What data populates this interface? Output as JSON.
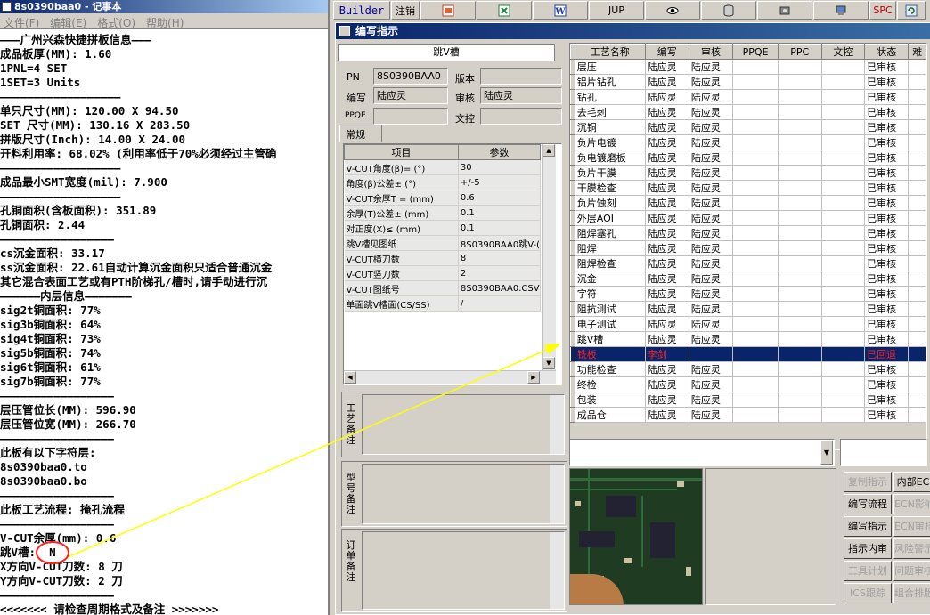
{
  "notepad": {
    "title": "8s0390baa0 - 记事本",
    "menu": [
      "文件(F)",
      "编辑(E)",
      "格式(O)",
      "帮助(H)"
    ],
    "lines": [
      "———广州兴森快捷拼板信息———",
      "成品板厚(MM): 1.60",
      "1PNL=4 SET",
      "1SET=3 Units",
      "——————————————————",
      "单只尺寸(MM): 120.00 X 94.50",
      "SET 尺寸(MM): 130.16 X 283.50",
      "拼版尺寸(Inch): 14.00 X 24.00",
      "开料利用率: 68.02% (利用率低于70%必须经过主管确",
      "——————————————————",
      "成品最小SMT宽度(mil): 7.900",
      "——————————————————",
      "孔铜面积(含板面积): 351.89",
      "孔铜面积: 2.44",
      "—————————————————",
      "cs沉金面积: 33.17",
      "ss沉金面积: 22.61自动计算沉金面积只适合普通沉金",
      "其它混合表面工艺或有PTH阶梯孔/槽时,请手动进行沉",
      "——————内层信息———————",
      "sig2t铜面积: 77%",
      "sig3b铜面积: 64%",
      "sig4t铜面积: 73%",
      "sig5b铜面积: 74%",
      "sig6t铜面积: 61%",
      "sig7b铜面积: 77%",
      "—————————————————",
      "层压管位长(MM): 596.90",
      "层压管位宽(MM): 266.70",
      "—————————————————",
      "此板有以下字符层:",
      "8s0390baa0.to",
      "8s0390baa0.bo",
      "—————————————————",
      "此板工艺流程: 掩孔流程",
      "—————————————————",
      "V-CUT余厚(mm): 0.6",
      "跳V槽:  N",
      "X方向V-CUT刀数: 8 刀",
      "Y方向V-CUT刀数: 2 刀",
      "—————————————————",
      "<<<<<<< 请检查周期格式及备注 >>>>>>>"
    ]
  },
  "toolbar": {
    "builder": "Builder",
    "logout": "注销",
    "jup": "JUP",
    "spc": "SPC",
    "icons": [
      "ppt-icon",
      "excel-icon",
      "word-icon",
      "eye-icon",
      "database-icon",
      "tools-icon",
      "computer-icon",
      "refresh-icon"
    ]
  },
  "dialog": {
    "title": "编写指示",
    "section_title": "跳V槽",
    "pn_label": "PN",
    "pn_value": "8S0390BAA0",
    "version_label": "版本",
    "version_value": "",
    "writer_label": "编写",
    "writer_value": "陆应灵",
    "reviewer_label": "审核",
    "reviewer_value": "陆应灵",
    "ppqe_label": "PPQE",
    "ppqe_value": "",
    "doc_control_label": "文控",
    "doc_control_value": "",
    "tab_general": "常规",
    "param_headers": [
      "项目",
      "参数"
    ],
    "params": [
      [
        "V-CUT角度(β)=  (°)",
        "30"
      ],
      [
        "角度(β)公差±  (°)",
        "+/-5"
      ],
      [
        "V-CUT余厚T =  (mm)",
        "0.6"
      ],
      [
        "余厚(T)公差±  (mm)",
        "0.1"
      ],
      [
        "对正度(X)≤  (mm)",
        "0.1"
      ],
      [
        "跳V槽见图纸",
        "8S0390BAA0跳V-("
      ],
      [
        "V-CUT横刀数",
        "8"
      ],
      [
        "V-CUT竖刀数",
        "2"
      ],
      [
        "V-CUT图纸号",
        "8S0390BAA0.CSV"
      ],
      [
        "单面跳V槽面(CS/SS)",
        "/"
      ]
    ],
    "note_labels": [
      "工艺备注",
      "型号备注",
      "订单备注"
    ]
  },
  "process_grid": {
    "headers": [
      "工艺名称",
      "编写",
      "审核",
      "PPQE",
      "PPC",
      "文控",
      "状态",
      "难"
    ],
    "rows": [
      [
        "层压",
        "陆应灵",
        "陆应灵",
        "",
        "",
        "",
        "已审核"
      ],
      [
        "铝片钻孔",
        "陆应灵",
        "陆应灵",
        "",
        "",
        "",
        "已审核"
      ],
      [
        "钻孔",
        "陆应灵",
        "陆应灵",
        "",
        "",
        "",
        "已审核"
      ],
      [
        "去毛刺",
        "陆应灵",
        "陆应灵",
        "",
        "",
        "",
        "已审核"
      ],
      [
        "沉铜",
        "陆应灵",
        "陆应灵",
        "",
        "",
        "",
        "已审核"
      ],
      [
        "负片电镀",
        "陆应灵",
        "陆应灵",
        "",
        "",
        "",
        "已审核"
      ],
      [
        "负电镀磨板",
        "陆应灵",
        "陆应灵",
        "",
        "",
        "",
        "已审核"
      ],
      [
        "负片干膜",
        "陆应灵",
        "陆应灵",
        "",
        "",
        "",
        "已审核"
      ],
      [
        "干膜检查",
        "陆应灵",
        "陆应灵",
        "",
        "",
        "",
        "已审核"
      ],
      [
        "负片蚀刻",
        "陆应灵",
        "陆应灵",
        "",
        "",
        "",
        "已审核"
      ],
      [
        "外层AOI",
        "陆应灵",
        "陆应灵",
        "",
        "",
        "",
        "已审核"
      ],
      [
        "阻焊塞孔",
        "陆应灵",
        "陆应灵",
        "",
        "",
        "",
        "已审核"
      ],
      [
        "阻焊",
        "陆应灵",
        "陆应灵",
        "",
        "",
        "",
        "已审核"
      ],
      [
        "阻焊检查",
        "陆应灵",
        "陆应灵",
        "",
        "",
        "",
        "已审核"
      ],
      [
        "沉金",
        "陆应灵",
        "陆应灵",
        "",
        "",
        "",
        "已审核"
      ],
      [
        "字符",
        "陆应灵",
        "陆应灵",
        "",
        "",
        "",
        "已审核"
      ],
      [
        "阻抗测试",
        "陆应灵",
        "陆应灵",
        "",
        "",
        "",
        "已审核"
      ],
      [
        "电子测试",
        "陆应灵",
        "陆应灵",
        "",
        "",
        "",
        "已审核"
      ],
      [
        "跳V槽",
        "陆应灵",
        "陆应灵",
        "",
        "",
        "",
        "已审核"
      ],
      [
        "铣板",
        "李剑",
        "",
        "",
        "",
        "",
        "已回退"
      ],
      [
        "功能检查",
        "陆应灵",
        "陆应灵",
        "",
        "",
        "",
        "已审核"
      ],
      [
        "终检",
        "陆应灵",
        "陆应灵",
        "",
        "",
        "",
        "已审核"
      ],
      [
        "包装",
        "陆应灵",
        "陆应灵",
        "",
        "",
        "",
        "已审核"
      ],
      [
        "成品仓",
        "陆应灵",
        "陆应灵",
        "",
        "",
        "",
        "已审核"
      ]
    ],
    "selected_row_index": 19
  },
  "action_buttons": [
    [
      "复制指示",
      "内部EC"
    ],
    [
      "编写流程",
      "ECN影响"
    ],
    [
      "编写指示",
      "ECN审核"
    ],
    [
      "指示内审",
      "风险警示"
    ],
    [
      "工具计划",
      "问题审核"
    ],
    [
      "ICS跟踪",
      "组合排版"
    ]
  ],
  "annotation": {
    "circled_value": "N",
    "colors": {
      "circle": "#ff2020",
      "arrow": "#ffff00"
    }
  },
  "colors": {
    "selection_bg": "#0a246a",
    "selection_fg": "#ff2020",
    "title_bar": "#0a246a",
    "window_bg": "#d4d0c8"
  }
}
